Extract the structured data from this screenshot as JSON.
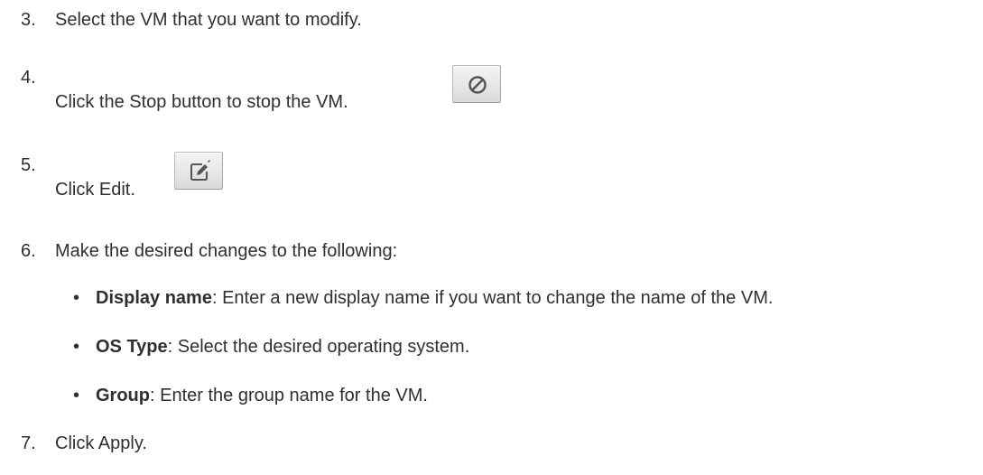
{
  "steps": [
    {
      "number": "3.",
      "text": "Select the VM that you want to modify."
    },
    {
      "number": "4.",
      "text": "Click the Stop button to stop the VM."
    },
    {
      "number": "5.",
      "text": "Click Edit."
    },
    {
      "number": "6.",
      "text": "Make the desired changes to the following:"
    },
    {
      "number": "7.",
      "text": "Click Apply."
    }
  ],
  "bullets": [
    {
      "marker": "•",
      "term": "Display name",
      "desc": ": Enter a new display name if you want to change the name of the VM."
    },
    {
      "marker": "•",
      "term": "OS Type",
      "desc": ": Select the desired operating system."
    },
    {
      "marker": "•",
      "term": "Group",
      "desc": ": Enter the group name for the VM."
    }
  ],
  "icons": {
    "stop": "stop-icon",
    "edit": "edit-icon"
  }
}
